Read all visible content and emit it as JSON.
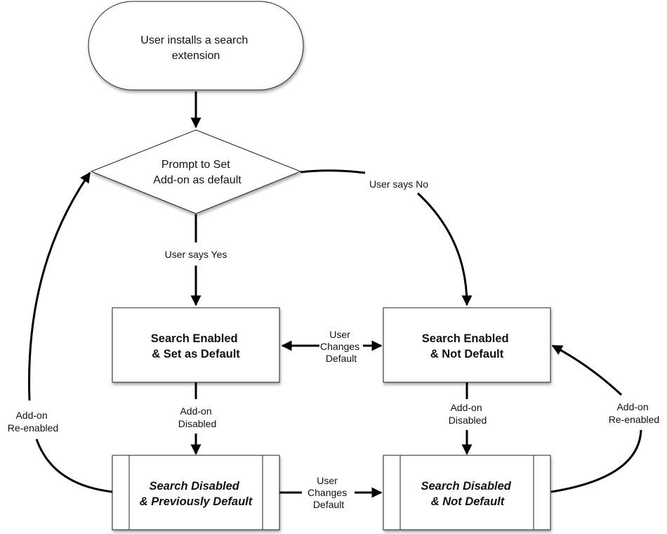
{
  "diagram": {
    "type": "flowchart",
    "nodes": {
      "start": {
        "shape": "terminator",
        "lines": [
          "User installs a search",
          "extension"
        ]
      },
      "prompt": {
        "shape": "decision",
        "lines": [
          "Prompt to Set",
          "Add-on as default"
        ]
      },
      "enabled_default": {
        "shape": "process",
        "style": "bold",
        "lines": [
          "Search Enabled",
          "& Set as Default"
        ]
      },
      "enabled_not_default": {
        "shape": "process",
        "style": "bold",
        "lines": [
          "Search Enabled",
          "& Not Default"
        ]
      },
      "disabled_prev_default": {
        "shape": "predefined-process",
        "style": "bold-italic",
        "lines": [
          "Search Disabled",
          "& Previously Default"
        ]
      },
      "disabled_not_default": {
        "shape": "predefined-process",
        "style": "bold-italic",
        "lines": [
          "Search Disabled",
          "& Not Default"
        ]
      }
    },
    "edges": {
      "install_to_prompt": {
        "from": "start",
        "to": "prompt",
        "label": []
      },
      "yes": {
        "from": "prompt",
        "to": "enabled_default",
        "label": [
          "User says Yes"
        ]
      },
      "no": {
        "from": "prompt",
        "to": "enabled_not_default",
        "label": [
          "User says No"
        ]
      },
      "change_default_top": {
        "from": "enabled_default",
        "to": "enabled_not_default",
        "bidirectional": true,
        "label": [
          "User",
          "Changes",
          "Default"
        ]
      },
      "disable_left": {
        "from": "enabled_default",
        "to": "disabled_prev_default",
        "label": [
          "Add-on",
          "Disabled"
        ]
      },
      "disable_right": {
        "from": "enabled_not_default",
        "to": "disabled_not_default",
        "label": [
          "Add-on",
          "Disabled"
        ]
      },
      "change_default_bottom": {
        "from": "disabled_prev_default",
        "to": "disabled_not_default",
        "label": [
          "User",
          "Changes",
          "Default"
        ]
      },
      "reenable_left": {
        "from": "disabled_prev_default",
        "to": "prompt",
        "label": [
          "Add-on",
          "Re-enabled"
        ]
      },
      "reenable_right": {
        "from": "disabled_not_default",
        "to": "enabled_not_default",
        "label": [
          "Add-on",
          "Re-enabled"
        ]
      }
    }
  }
}
